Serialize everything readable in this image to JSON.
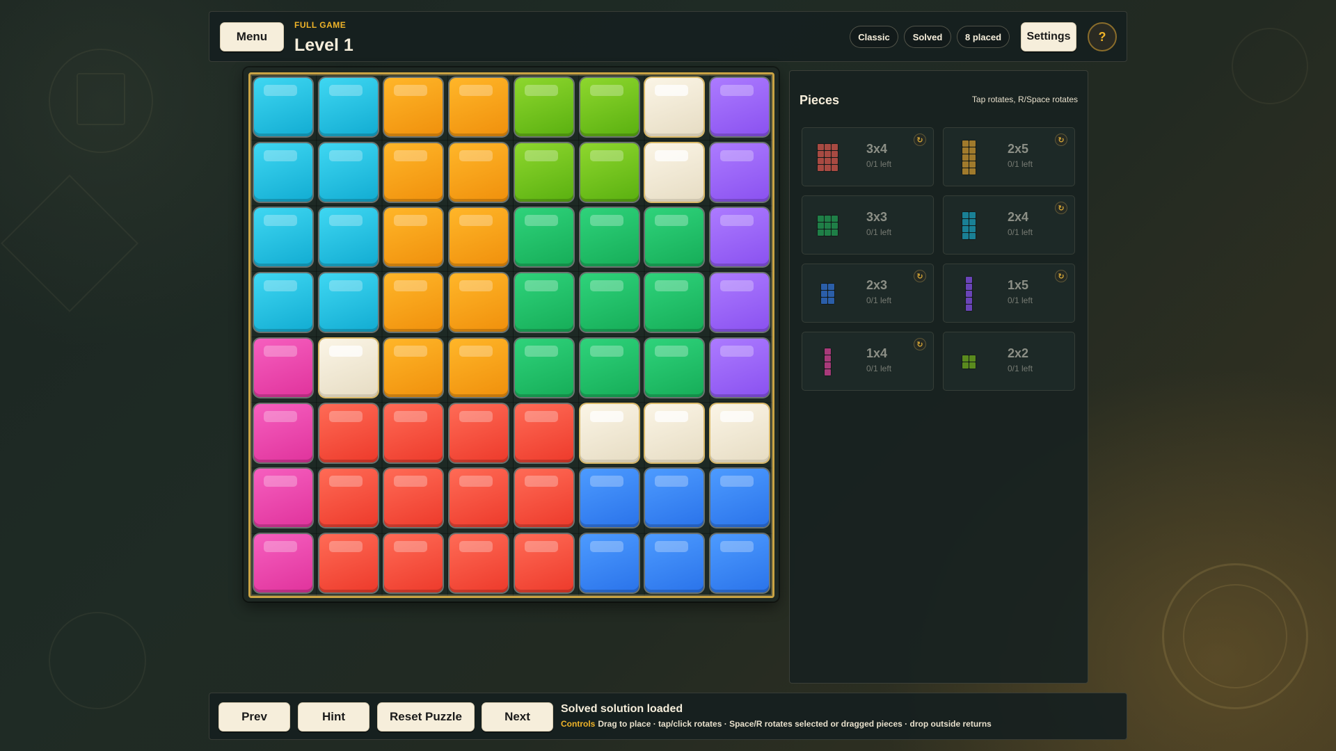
{
  "header": {
    "menu_label": "Menu",
    "eyebrow": "FULL GAME",
    "title": "Level 1",
    "mode_pill": "Classic",
    "status_pill": "Solved",
    "placed_pill": "8 placed",
    "settings_label": "Settings",
    "help_label": "?"
  },
  "board": {
    "rows": 8,
    "cols": 8,
    "cells": [
      [
        "cyan",
        "cyan",
        "orange",
        "orange",
        "lime",
        "lime",
        "cream",
        "purple"
      ],
      [
        "cyan",
        "cyan",
        "orange",
        "orange",
        "lime",
        "lime",
        "cream",
        "purple"
      ],
      [
        "cyan",
        "cyan",
        "orange",
        "orange",
        "green",
        "green",
        "green",
        "purple"
      ],
      [
        "cyan",
        "cyan",
        "orange",
        "orange",
        "green",
        "green",
        "green",
        "purple"
      ],
      [
        "pink",
        "cream",
        "orange",
        "orange",
        "green",
        "green",
        "green",
        "purple"
      ],
      [
        "pink",
        "red",
        "red",
        "red",
        "red",
        "cream",
        "cream",
        "cream"
      ],
      [
        "pink",
        "red",
        "red",
        "red",
        "red",
        "blue",
        "blue",
        "blue"
      ],
      [
        "pink",
        "red",
        "red",
        "red",
        "red",
        "blue",
        "blue",
        "blue"
      ]
    ]
  },
  "pieces_panel": {
    "title": "Pieces",
    "hint": "Tap rotates, R/Space rotates",
    "rotate_icon": "rotate-icon",
    "pieces": [
      {
        "size": "3x4",
        "left": "0/1 left",
        "grid_cols": 3,
        "grid_rows": 4,
        "color": "#a84a42",
        "rotatable": true
      },
      {
        "size": "2x5",
        "left": "0/1 left",
        "grid_cols": 2,
        "grid_rows": 5,
        "color": "#a07a2c",
        "rotatable": true
      },
      {
        "size": "3x3",
        "left": "0/1 left",
        "grid_cols": 3,
        "grid_rows": 3,
        "color": "#1f7f47",
        "rotatable": false
      },
      {
        "size": "2x4",
        "left": "0/1 left",
        "grid_cols": 2,
        "grid_rows": 4,
        "color": "#1a8095",
        "rotatable": true
      },
      {
        "size": "2x3",
        "left": "0/1 left",
        "grid_cols": 2,
        "grid_rows": 3,
        "color": "#2b5ea8",
        "rotatable": true
      },
      {
        "size": "1x5",
        "left": "0/1 left",
        "grid_cols": 1,
        "grid_rows": 5,
        "color": "#6a44b8",
        "rotatable": true
      },
      {
        "size": "1x4",
        "left": "0/1 left",
        "grid_cols": 1,
        "grid_rows": 4,
        "color": "#a83a7a",
        "rotatable": true
      },
      {
        "size": "2x2",
        "left": "0/1 left",
        "grid_cols": 2,
        "grid_rows": 2,
        "color": "#5a8a1e",
        "rotatable": false
      }
    ]
  },
  "footer": {
    "prev_label": "Prev",
    "hint_label": "Hint",
    "reset_label": "Reset Puzzle",
    "next_label": "Next",
    "status_title": "Solved solution loaded",
    "controls_label": "Controls",
    "controls_text": "Drag to place · tap/click rotates · Space/R rotates selected or dragged pieces · drop outside returns"
  }
}
